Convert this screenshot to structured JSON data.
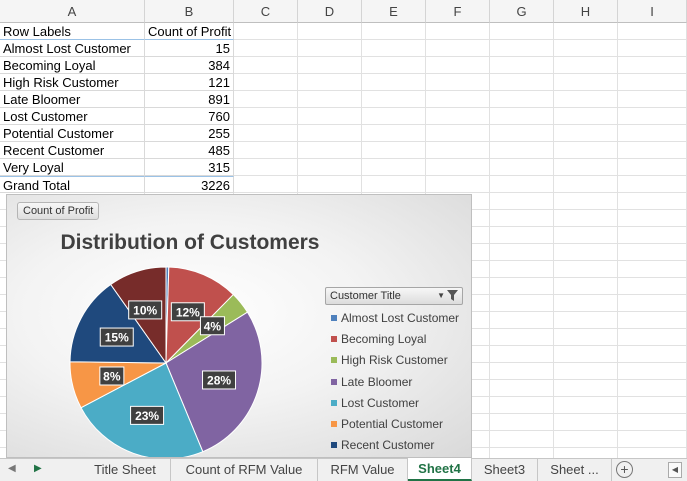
{
  "columns": [
    "A",
    "B",
    "C",
    "D",
    "E",
    "F",
    "G",
    "H",
    "I"
  ],
  "pivot": {
    "header_row_labels": "Row Labels",
    "header_count": "Count of Profit",
    "rows": [
      {
        "label": "Almost Lost Customer",
        "value": "15"
      },
      {
        "label": "Becoming Loyal",
        "value": "384"
      },
      {
        "label": "High Risk Customer",
        "value": "121"
      },
      {
        "label": "Late Bloomer",
        "value": "891"
      },
      {
        "label": "Lost Customer",
        "value": "760"
      },
      {
        "label": "Potential Customer",
        "value": "255"
      },
      {
        "label": "Recent Customer",
        "value": "485"
      },
      {
        "label": "Very Loyal",
        "value": "315"
      }
    ],
    "total_label": "Grand Total",
    "total_value": "3226"
  },
  "chart": {
    "field_button": "Count of Profit",
    "legend_field": "Customer Title",
    "filter_icon": "funnel-icon"
  },
  "chart_data": {
    "type": "pie",
    "title": "Distribution of Customers",
    "series": [
      {
        "category": "Almost Lost Customer",
        "value": 15,
        "color": "#4f81bd",
        "label": ""
      },
      {
        "category": "Becoming Loyal",
        "value": 384,
        "color": "#c0504d",
        "label": "12%"
      },
      {
        "category": "High Risk Customer",
        "value": 121,
        "color": "#9bbb59",
        "label": "4%"
      },
      {
        "category": "Late Bloomer",
        "value": 891,
        "color": "#8064a2",
        "label": "28%"
      },
      {
        "category": "Lost Customer",
        "value": 760,
        "color": "#4bacc6",
        "label": "23%"
      },
      {
        "category": "Potential Customer",
        "value": 255,
        "color": "#f79646",
        "label": "8%"
      },
      {
        "category": "Recent Customer",
        "value": 485,
        "color": "#1f497d",
        "label": "15%"
      },
      {
        "category": "Very Loyal",
        "value": 315,
        "color": "#772c2a",
        "label": "10%"
      }
    ],
    "legend_placement": "right"
  },
  "tabs": [
    {
      "label": "Title Sheet",
      "active": false
    },
    {
      "label": "Count of RFM Value",
      "active": false
    },
    {
      "label": "RFM Value",
      "active": false
    },
    {
      "label": "Sheet4",
      "active": true
    },
    {
      "label": "Sheet3",
      "active": false
    },
    {
      "label": "Sheet ...",
      "active": false
    }
  ],
  "tab_add": "+",
  "nav_prev": "◀",
  "nav_next": "▶"
}
